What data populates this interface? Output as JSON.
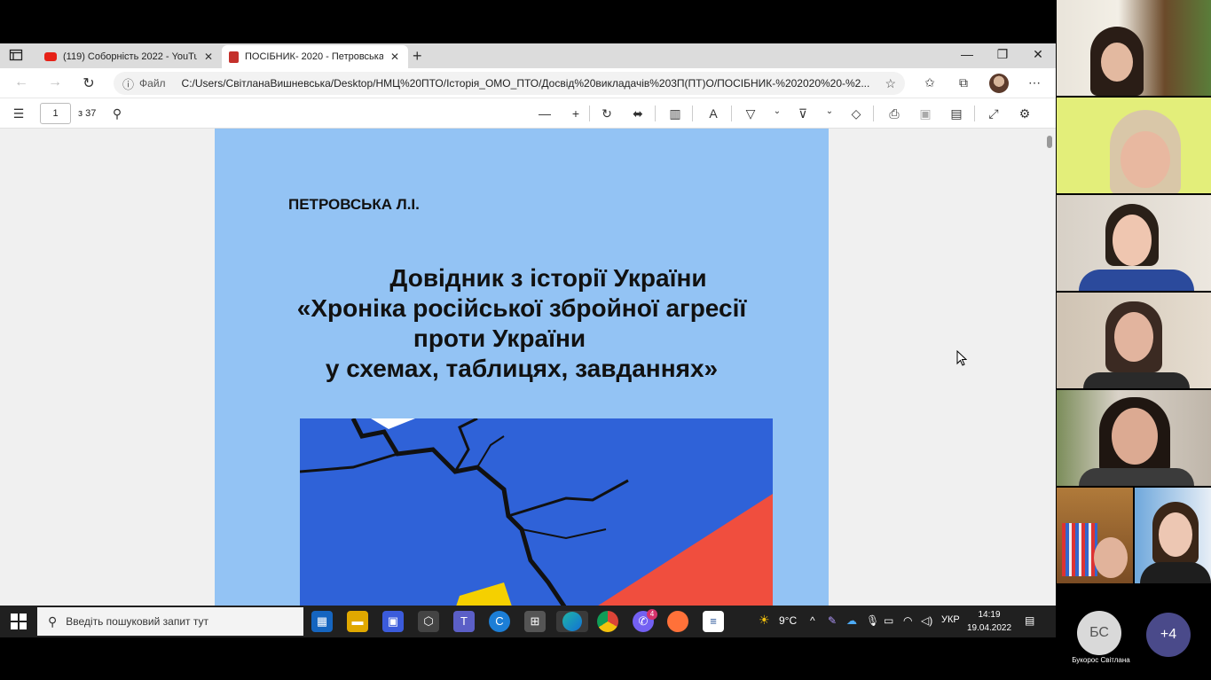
{
  "browser": {
    "tabs": [
      {
        "label": "(119) Соборність 2022 - YouTube",
        "favicon": "youtube-icon",
        "active": false
      },
      {
        "label": "ПОСІБНИК- 2020 - Петровська",
        "favicon": "pdf-icon",
        "active": true
      }
    ],
    "address": {
      "scheme_label": "Файл",
      "url": "C:/Users/СвітланаВишневська/Desktop/НМЦ%20ПТО/Історія_ОМО_ПТО/Досвід%20викладачів%203П(ПТ)О/ПОСІБНИК-%202020%20-%2..."
    }
  },
  "pdf_toolbar": {
    "page_number": "1",
    "page_total": "з 37"
  },
  "document": {
    "author": "ПЕТРОВСЬКА Л.І.",
    "title_lines": [
      "Довідник з історії України",
      "«Хроніка російської збройної агресії",
      "проти України",
      "у схемах, таблицях, завданнях»"
    ]
  },
  "taskbar": {
    "search_placeholder": "Введіть пошуковий запит тут",
    "weather": "9°C",
    "language": "УКР",
    "time": "14:19",
    "date": "19.04.2022",
    "viber_badge": "4"
  },
  "participants": {
    "initials": "БС",
    "name": "Букорос Світлана",
    "more": "+4"
  },
  "colors": {
    "page_bg": "#93c3f4",
    "ukraine_blue": "#2f62d8",
    "russia_red": "#f04e3e",
    "ukraine_yellow": "#f5d000"
  }
}
